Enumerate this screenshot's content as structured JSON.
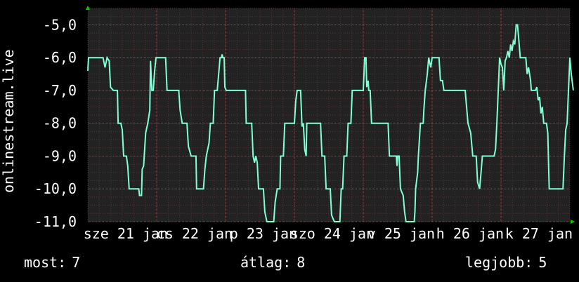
{
  "chart_data": {
    "type": "line",
    "ylabel": "onlinestream.live",
    "ylim": [
      -11.0,
      -4.5
    ],
    "yticks": [
      "-5,0",
      "-6,0",
      "-7,0",
      "-8,0",
      "-9,0",
      "-10,0",
      "-11,0"
    ],
    "ytick_values": [
      -5,
      -6,
      -7,
      -8,
      -9,
      -10,
      -11
    ],
    "xticks": [
      {
        "label": "sze 21 jan",
        "x": 0.55
      },
      {
        "label": "cs 22 jan",
        "x": 1.55
      },
      {
        "label": "p 23 jan",
        "x": 2.55
      },
      {
        "label": "szo 24 jan",
        "x": 3.55
      },
      {
        "label": "v 25 jan",
        "x": 4.55
      },
      {
        "label": "h 26 jan",
        "x": 5.55
      },
      {
        "label": "k 27 jan",
        "x": 6.55
      }
    ],
    "xlim": [
      0,
      7
    ],
    "grid": true,
    "series": [
      {
        "color": "#7fffd4",
        "points": [
          [
            0.0,
            -6.4
          ],
          [
            0.01,
            -6.0
          ],
          [
            0.22,
            -6.0
          ],
          [
            0.25,
            -6.3
          ],
          [
            0.28,
            -6.0
          ],
          [
            0.31,
            -6.1
          ],
          [
            0.33,
            -6.9
          ],
          [
            0.37,
            -7.0
          ],
          [
            0.43,
            -7.0
          ],
          [
            0.44,
            -8.0
          ],
          [
            0.48,
            -8.0
          ],
          [
            0.5,
            -8.2
          ],
          [
            0.52,
            -9.0
          ],
          [
            0.56,
            -9.0
          ],
          [
            0.58,
            -9.3
          ],
          [
            0.6,
            -10.0
          ],
          [
            0.74,
            -10.0
          ],
          [
            0.75,
            -10.2
          ],
          [
            0.78,
            -10.2
          ],
          [
            0.79,
            -9.4
          ],
          [
            0.81,
            -9.3
          ],
          [
            0.84,
            -8.3
          ],
          [
            0.87,
            -8.0
          ],
          [
            0.9,
            -7.6
          ],
          [
            0.91,
            -6.1
          ],
          [
            0.93,
            -7.0
          ],
          [
            0.95,
            -7.0
          ],
          [
            0.97,
            -6.4
          ],
          [
            0.99,
            -6.0
          ],
          [
            1.13,
            -6.0
          ],
          [
            1.15,
            -7.0
          ],
          [
            1.32,
            -7.0
          ],
          [
            1.34,
            -7.6
          ],
          [
            1.37,
            -8.0
          ],
          [
            1.44,
            -8.0
          ],
          [
            1.46,
            -8.7
          ],
          [
            1.5,
            -9.0
          ],
          [
            1.57,
            -9.0
          ],
          [
            1.58,
            -10.0
          ],
          [
            1.68,
            -10.0
          ],
          [
            1.7,
            -9.4
          ],
          [
            1.72,
            -9.0
          ],
          [
            1.76,
            -8.6
          ],
          [
            1.78,
            -8.0
          ],
          [
            1.82,
            -8.0
          ],
          [
            1.84,
            -7.0
          ],
          [
            1.88,
            -7.0
          ],
          [
            1.9,
            -6.5
          ],
          [
            1.92,
            -6.0
          ],
          [
            1.94,
            -6.0
          ],
          [
            1.95,
            -5.9
          ],
          [
            1.96,
            -6.0
          ],
          [
            1.98,
            -6.0
          ],
          [
            1.99,
            -6.9
          ],
          [
            2.01,
            -7.0
          ],
          [
            2.29,
            -7.0
          ],
          [
            2.3,
            -8.0
          ],
          [
            2.38,
            -8.0
          ],
          [
            2.4,
            -9.0
          ],
          [
            2.42,
            -9.2
          ],
          [
            2.44,
            -9.0
          ],
          [
            2.46,
            -9.2
          ],
          [
            2.48,
            -10.0
          ],
          [
            2.55,
            -10.0
          ],
          [
            2.57,
            -10.7
          ],
          [
            2.6,
            -11.0
          ],
          [
            2.7,
            -11.0
          ],
          [
            2.72,
            -10.4
          ],
          [
            2.75,
            -10.0
          ],
          [
            2.79,
            -10.0
          ],
          [
            2.8,
            -9.0
          ],
          [
            2.84,
            -9.0
          ],
          [
            2.86,
            -8.0
          ],
          [
            3.0,
            -8.0
          ],
          [
            3.02,
            -7.3
          ],
          [
            3.04,
            -7.0
          ],
          [
            3.09,
            -7.0
          ],
          [
            3.11,
            -8.1
          ],
          [
            3.13,
            -8.0
          ],
          [
            3.15,
            -8.8
          ],
          [
            3.17,
            -9.0
          ],
          [
            3.18,
            -8.0
          ],
          [
            3.38,
            -8.0
          ],
          [
            3.4,
            -9.0
          ],
          [
            3.44,
            -9.0
          ],
          [
            3.46,
            -10.0
          ],
          [
            3.52,
            -10.0
          ],
          [
            3.54,
            -10.8
          ],
          [
            3.58,
            -11.0
          ],
          [
            3.66,
            -11.0
          ],
          [
            3.68,
            -10.0
          ],
          [
            3.7,
            -10.0
          ],
          [
            3.72,
            -9.0
          ],
          [
            3.76,
            -9.0
          ],
          [
            3.78,
            -8.0
          ],
          [
            3.82,
            -8.0
          ],
          [
            3.84,
            -7.0
          ],
          [
            4.0,
            -7.0
          ],
          [
            4.02,
            -6.0
          ],
          [
            4.04,
            -6.0
          ],
          [
            4.05,
            -6.9
          ],
          [
            4.07,
            -6.7
          ],
          [
            4.08,
            -7.0
          ],
          [
            4.1,
            -7.0
          ],
          [
            4.12,
            -8.0
          ],
          [
            4.36,
            -8.0
          ],
          [
            4.38,
            -9.0
          ],
          [
            4.48,
            -9.0
          ],
          [
            4.49,
            -9.3
          ],
          [
            4.5,
            -9.0
          ],
          [
            4.52,
            -9.0
          ],
          [
            4.54,
            -10.0
          ],
          [
            4.58,
            -10.2
          ],
          [
            4.6,
            -10.7
          ],
          [
            4.62,
            -11.0
          ],
          [
            4.74,
            -11.0
          ],
          [
            4.75,
            -10.7
          ],
          [
            4.76,
            -10.0
          ],
          [
            4.79,
            -9.5
          ],
          [
            4.8,
            -9.0
          ],
          [
            4.83,
            -8.0
          ],
          [
            4.87,
            -8.0
          ],
          [
            4.88,
            -7.6
          ],
          [
            4.9,
            -7.0
          ],
          [
            4.93,
            -6.5
          ],
          [
            4.95,
            -6.0
          ],
          [
            4.98,
            -6.3
          ],
          [
            5.0,
            -6.0
          ],
          [
            5.1,
            -6.0
          ],
          [
            5.12,
            -6.7
          ],
          [
            5.15,
            -6.7
          ],
          [
            5.17,
            -7.0
          ],
          [
            5.48,
            -7.0
          ],
          [
            5.5,
            -7.5
          ],
          [
            5.52,
            -8.0
          ],
          [
            5.56,
            -8.3
          ],
          [
            5.59,
            -9.0
          ],
          [
            5.64,
            -9.0
          ],
          [
            5.66,
            -9.8
          ],
          [
            5.69,
            -10.0
          ],
          [
            5.71,
            -9.5
          ],
          [
            5.73,
            -9.0
          ],
          [
            5.9,
            -9.0
          ],
          [
            5.92,
            -8.8
          ],
          [
            5.94,
            -8.0
          ],
          [
            5.96,
            -7.0
          ],
          [
            5.98,
            -6.0
          ],
          [
            6.0,
            -6.2
          ],
          [
            6.02,
            -6.3
          ],
          [
            6.04,
            -7.0
          ],
          [
            6.06,
            -6.1
          ],
          [
            6.08,
            -6.0
          ],
          [
            6.1,
            -5.8
          ],
          [
            6.12,
            -6.0
          ],
          [
            6.14,
            -5.6
          ],
          [
            6.16,
            -5.8
          ],
          [
            6.18,
            -5.5
          ],
          [
            6.2,
            -5.6
          ],
          [
            6.22,
            -5.0
          ],
          [
            6.24,
            -5.0
          ],
          [
            6.26,
            -5.5
          ],
          [
            6.28,
            -6.0
          ],
          [
            6.36,
            -6.0
          ],
          [
            6.38,
            -6.5
          ],
          [
            6.4,
            -6.3
          ],
          [
            6.43,
            -6.7
          ],
          [
            6.44,
            -7.0
          ],
          [
            6.5,
            -7.0
          ],
          [
            6.52,
            -6.9
          ],
          [
            6.54,
            -7.3
          ],
          [
            6.56,
            -7.2
          ],
          [
            6.58,
            -7.7
          ],
          [
            6.6,
            -7.5
          ],
          [
            6.62,
            -8.0
          ],
          [
            6.66,
            -8.0
          ],
          [
            6.68,
            -8.3
          ],
          [
            6.7,
            -10.0
          ],
          [
            6.9,
            -10.0
          ],
          [
            6.92,
            -9.0
          ],
          [
            6.94,
            -8.2
          ],
          [
            6.96,
            -8.0
          ],
          [
            6.98,
            -7.0
          ],
          [
            7.0,
            -6.0
          ],
          [
            7.02,
            -6.5
          ],
          [
            7.05,
            -7.0
          ]
        ]
      }
    ]
  },
  "footer": {
    "now_label": "most:",
    "now_value": "7",
    "avg_label": "átlag:",
    "avg_value": "8",
    "max_label": "legjobb:",
    "max_value": "5"
  },
  "colors": {
    "background": "#000000",
    "plot_background": "#222222",
    "grid_minor": "#553333",
    "grid_major": "#884444",
    "line": "#7fffd4",
    "text": "#ffffff",
    "axis_arrow": "#00cc00"
  }
}
